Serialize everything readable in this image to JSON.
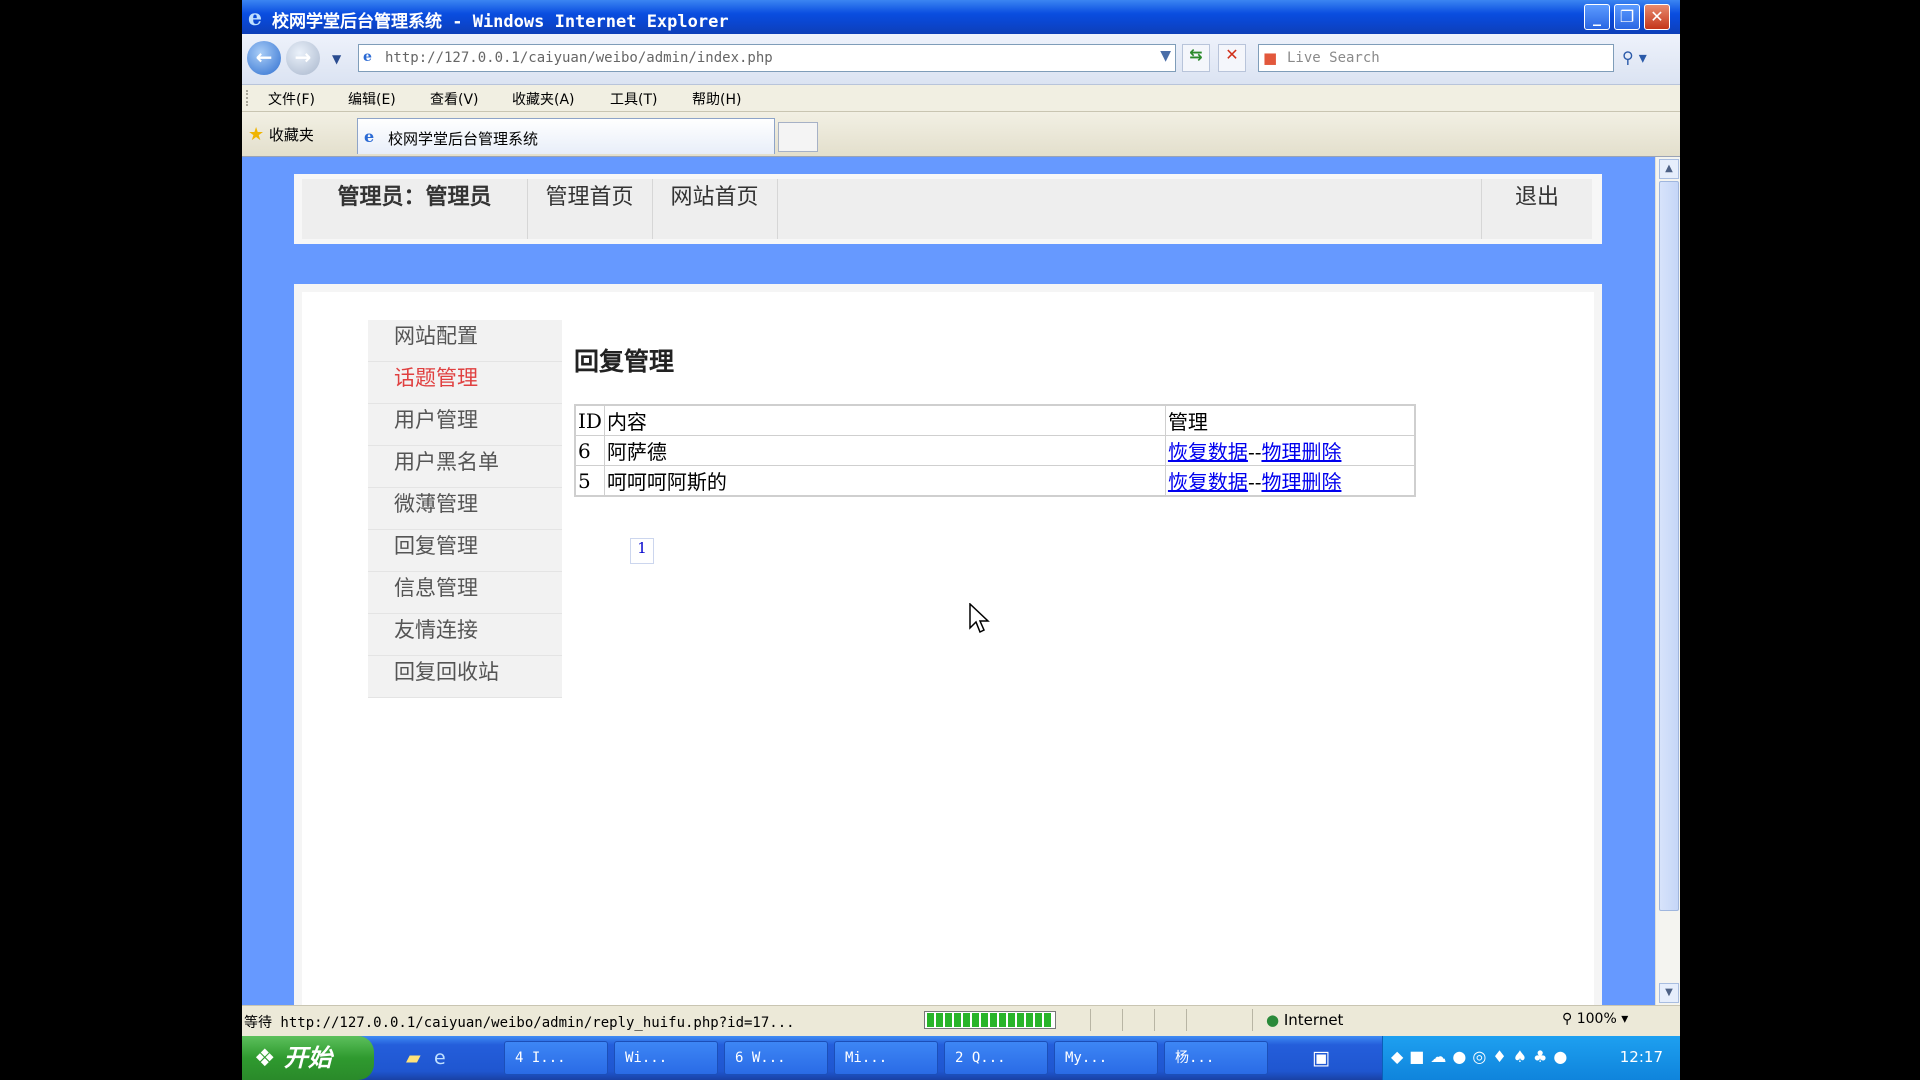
{
  "window": {
    "title": "校网学堂后台管理系统 - Windows Internet Explorer",
    "minimize": "_",
    "restore": "❐",
    "close": "✕"
  },
  "navbar": {
    "url": "http://127.0.0.1/caiyuan/weibo/admin/index.php",
    "search_placeholder": "Live Search"
  },
  "menu": [
    "文件(F)",
    "编辑(E)",
    "查看(V)",
    "收藏夹(A)",
    "工具(T)",
    "帮助(H)"
  ],
  "tabs": {
    "favorites": "收藏夹",
    "active_tab": "校网学堂后台管理系统"
  },
  "page": {
    "admin_label": "管理员：管理员",
    "nav_admin_home": "管理首页",
    "nav_site_home": "网站首页",
    "logout": "退出",
    "sidebar": [
      "网站配置",
      "话题管理",
      "用户管理",
      "用户黑名单",
      "微薄管理",
      "回复管理",
      "信息管理",
      "友情连接",
      "回复回收站"
    ],
    "sidebar_active_index": 1,
    "content_title": "回复管理",
    "table": {
      "headers": [
        "ID",
        "内容",
        "管理"
      ],
      "rows": [
        {
          "id": "6",
          "content": "阿萨德",
          "restore": "恢复数据",
          "sep": "--",
          "delete": "物理删除"
        },
        {
          "id": "5",
          "content": "呵呵呵阿斯的",
          "restore": "恢复数据",
          "sep": "--",
          "delete": "物理删除"
        }
      ]
    },
    "pager": "1"
  },
  "status": {
    "text": "等待 http://127.0.0.1/caiyuan/weibo/admin/reply_huifu.php?id=17...",
    "progress": 1.0,
    "zone": "Internet",
    "zoom": "100%"
  },
  "taskbar": {
    "start": "开始",
    "tasks": [
      "4 I...",
      "Wi...",
      "6 W...",
      "Mi...",
      "2 Q...",
      "My...",
      "杨..."
    ],
    "clock": "12:17"
  }
}
